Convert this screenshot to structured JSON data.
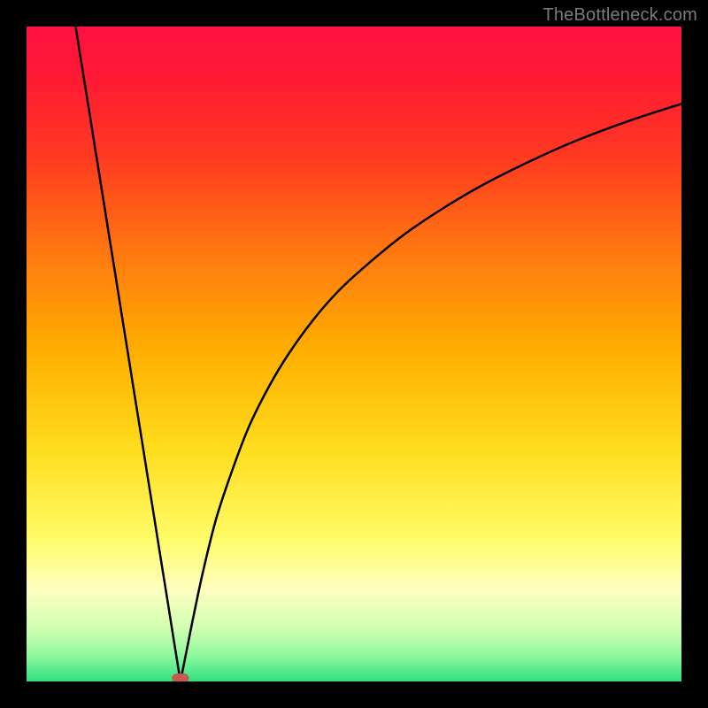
{
  "watermark": "TheBottleneck.com",
  "chart_data": {
    "type": "line",
    "title": "",
    "xlabel": "",
    "ylabel": "",
    "xlim": [
      0,
      100
    ],
    "ylim": [
      0,
      100
    ],
    "grid": false,
    "legend": false,
    "background_gradient_stops": [
      {
        "pos": 0.0,
        "color": "#ff1040"
      },
      {
        "pos": 0.08,
        "color": "#ff1a34"
      },
      {
        "pos": 0.2,
        "color": "#ff3a20"
      },
      {
        "pos": 0.35,
        "color": "#ff7a10"
      },
      {
        "pos": 0.5,
        "color": "#ffb000"
      },
      {
        "pos": 0.65,
        "color": "#ffde20"
      },
      {
        "pos": 0.78,
        "color": "#fffb66"
      },
      {
        "pos": 0.86,
        "color": "#ffffc0"
      },
      {
        "pos": 0.92,
        "color": "#cfffb0"
      },
      {
        "pos": 0.96,
        "color": "#90f8a0"
      },
      {
        "pos": 1.0,
        "color": "#30e080"
      }
    ],
    "series": [
      {
        "name": "left-branch",
        "stroke": "#000000",
        "x": [
          7.5,
          8.5,
          9.5,
          10.5,
          11.5,
          12.5,
          13.5,
          14.5,
          15.5,
          16.5,
          17.5,
          18.5,
          19.5,
          20.5,
          21.5,
          22.5,
          23.0,
          23.5
        ],
        "y": [
          100,
          93.7,
          87.5,
          81.2,
          75.0,
          68.7,
          62.5,
          56.2,
          50.0,
          43.7,
          37.5,
          31.2,
          25.0,
          18.7,
          12.5,
          6.2,
          3.1,
          0.0
        ]
      },
      {
        "name": "right-branch",
        "stroke": "#000000",
        "x": [
          23.5,
          24.5,
          25.5,
          27.0,
          29.0,
          31.5,
          34.0,
          37.0,
          40.0,
          44.0,
          48.0,
          53.0,
          58.0,
          64.0,
          70.0,
          77.0,
          84.0,
          92.0,
          100.0
        ],
        "y": [
          0.0,
          5.0,
          10.0,
          17.0,
          25.0,
          32.5,
          39.0,
          45.0,
          50.0,
          55.5,
          60.0,
          64.5,
          68.5,
          72.5,
          76.0,
          79.5,
          82.6,
          85.6,
          88.2
        ]
      }
    ],
    "marker": {
      "name": "minimum-pill",
      "x": 23.5,
      "y": 0.5,
      "width_pct": 2.6,
      "height_pct": 1.4,
      "color": "#c85a50"
    }
  }
}
